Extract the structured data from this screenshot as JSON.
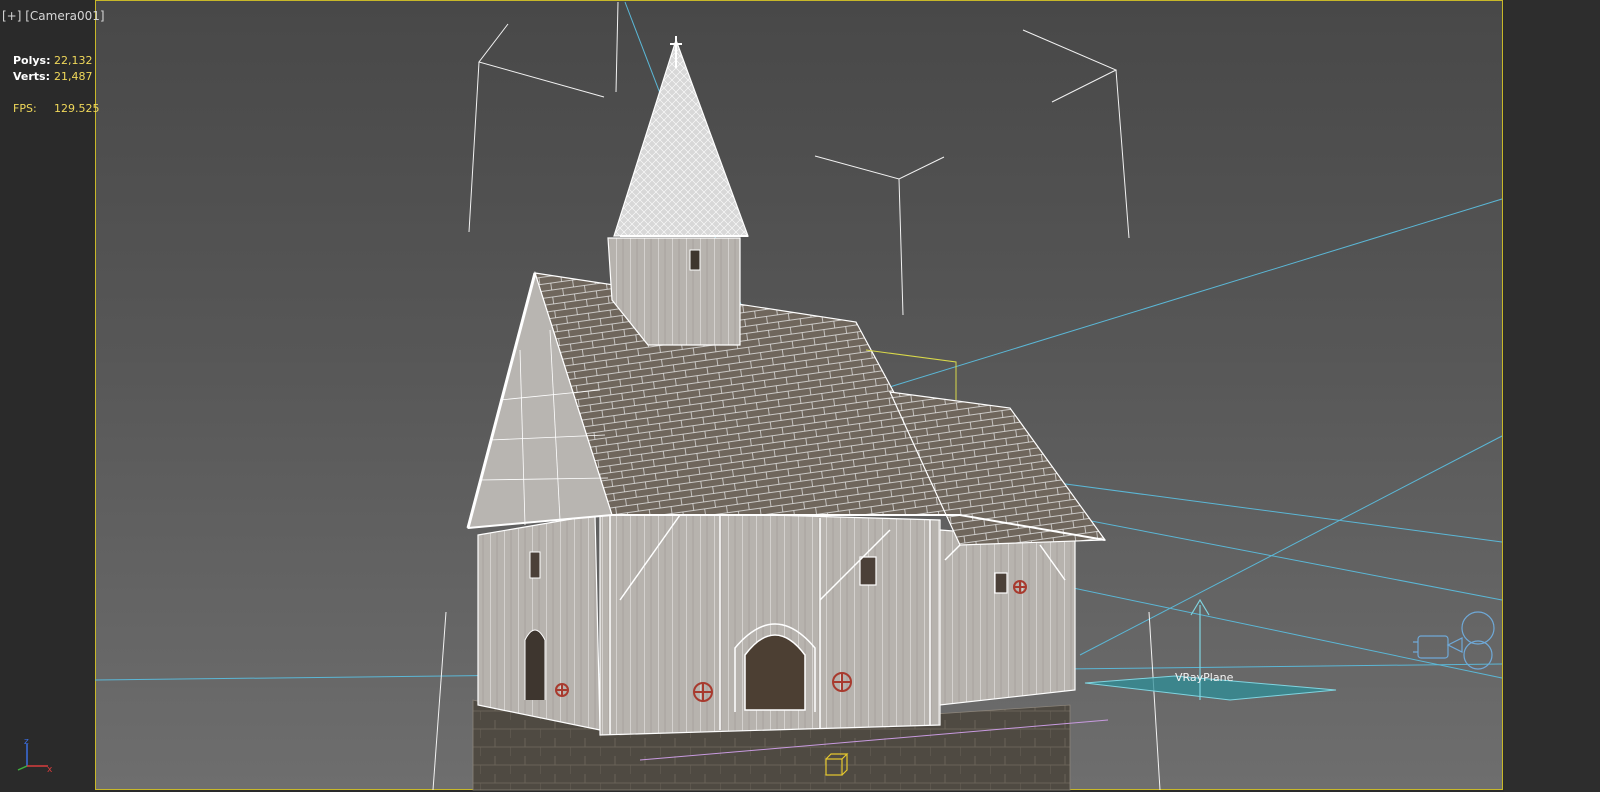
{
  "viewport": {
    "plus_label": "[+]",
    "camera_label": "[Camera001]"
  },
  "stats": {
    "polys_label": "Polys:",
    "polys_value": "22,132",
    "verts_label": "Verts:",
    "verts_value": "21,487",
    "fps_label": "FPS:",
    "fps_value": "129.525"
  },
  "scene": {
    "plane_object_label": "VRayPlane",
    "axis_labels": {
      "z": "z",
      "x": "x"
    }
  },
  "colors": {
    "safe_frame": "#c8b829",
    "wireframe": "#ffffff",
    "light_lines": "#5bb7d6",
    "stat_values": "#f0d85a",
    "selected_bbox": "#d9d94a",
    "vray_plane": "#2e8f98"
  },
  "icons": [
    "camera-icon",
    "light-cube-icon",
    "axis-gizmo-icon"
  ]
}
